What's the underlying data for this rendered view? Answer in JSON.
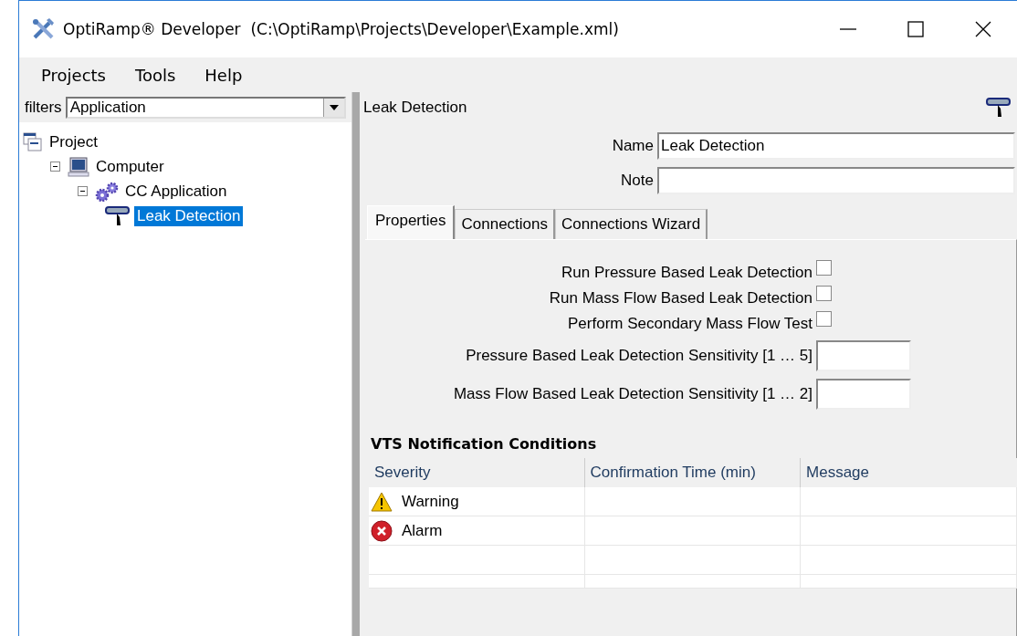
{
  "window": {
    "title": "OptiRamp® Developer  (C:\\OptiRamp\\Projects\\Developer\\Example.xml)"
  },
  "menu": [
    "Projects",
    "Tools",
    "Help"
  ],
  "filter": {
    "label": "filters",
    "value": "Application"
  },
  "tree": [
    {
      "label": "Project",
      "kind": "project",
      "selected": false,
      "children": [
        {
          "label": "Computer",
          "kind": "computer",
          "selected": false,
          "expanded": true,
          "children": [
            {
              "label": "CC Application",
              "kind": "application",
              "selected": false,
              "expanded": true,
              "children": [
                {
                  "label": "Leak Detection",
                  "kind": "module",
                  "selected": true
                }
              ]
            }
          ]
        }
      ]
    }
  ],
  "detail": {
    "header": "Leak Detection",
    "fields": [
      {
        "label": "Name",
        "value": "Leak Detection"
      },
      {
        "label": "Note"
      }
    ],
    "tabs": [
      {
        "label": "Properties",
        "selected": true
      },
      {
        "label": "Connections",
        "selected": false
      },
      {
        "label": "Connections Wizard",
        "selected": false
      }
    ],
    "properties": [
      {
        "kind": "checkbox",
        "label": "Run Pressure Based Leak Detection",
        "checked": false
      },
      {
        "kind": "checkbox",
        "label": "Run Mass Flow Based Leak Detection",
        "checked": false
      },
      {
        "kind": "checkbox",
        "label": "Perform Secondary Mass Flow Test",
        "checked": false
      },
      {
        "kind": "number",
        "label": "Pressure Based Leak Detection Sensitivity [1 … 5]"
      },
      {
        "kind": "number",
        "label": "Mass Flow Based Leak Detection Sensitivity [1 … 2]"
      }
    ],
    "section_title": "VTS Notification Conditions",
    "table": {
      "columns": [
        "Severity",
        "Confirmation Time (min)",
        "Message"
      ],
      "rows": [
        {
          "kind": "warning",
          "severity": "Warning"
        },
        {
          "kind": "alarm",
          "severity": "Alarm"
        }
      ]
    }
  }
}
